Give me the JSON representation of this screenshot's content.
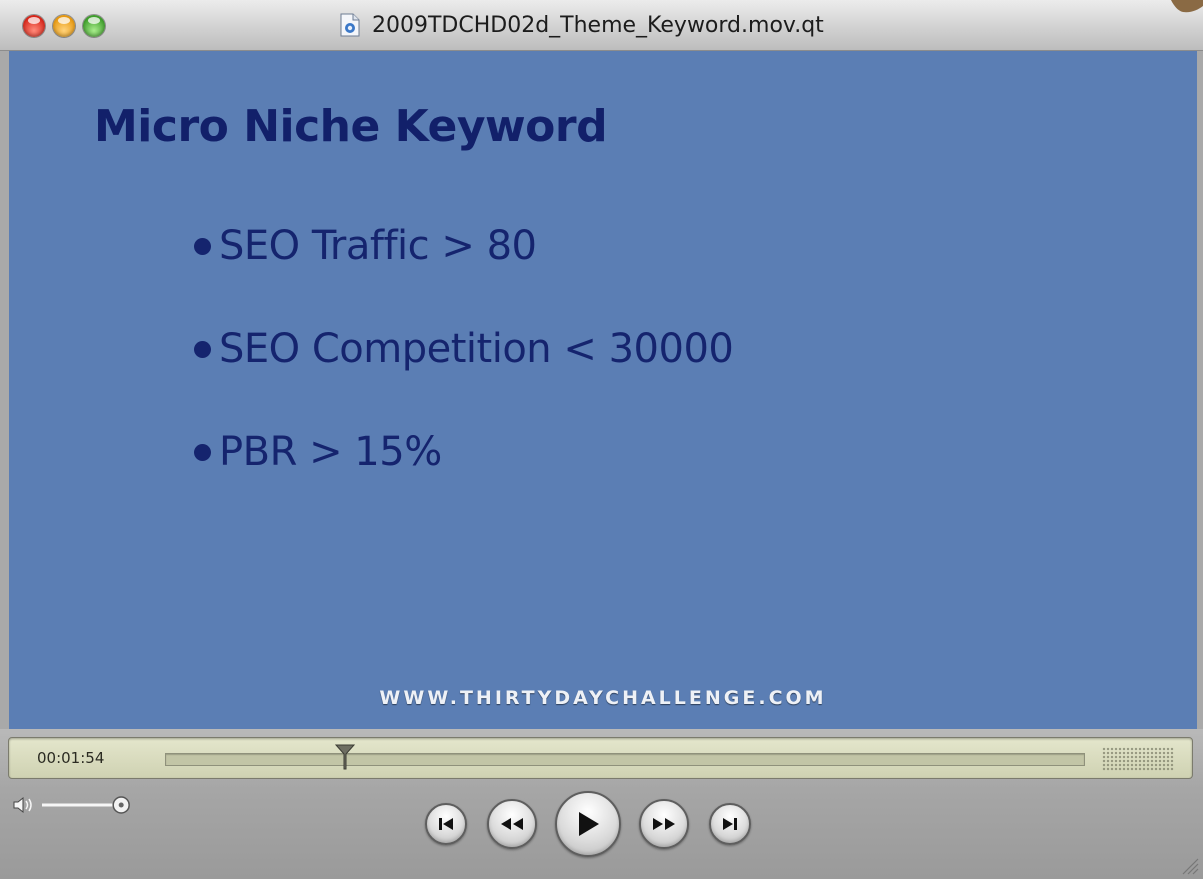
{
  "window": {
    "title": "2009TDCHD02d_Theme_Keyword.mov.qt"
  },
  "slide": {
    "title": "Micro Niche Keyword",
    "bullets": [
      "SEO Traffic > 80",
      "SEO Competition < 30000",
      "PBR > 15%"
    ],
    "watermark": "WWW.THIRTYDAYCHALLENGE.COM"
  },
  "controller": {
    "timecode": "00:01:54",
    "playback_progress": 0.196,
    "volume_level": 0.9,
    "buttons": [
      "skip-to-start",
      "rewind",
      "play",
      "fast-forward",
      "skip-to-end"
    ]
  },
  "colors": {
    "slide_background": "#5b7eb4",
    "slide_text": "#15246e",
    "lcd": "#d8dbbd"
  }
}
